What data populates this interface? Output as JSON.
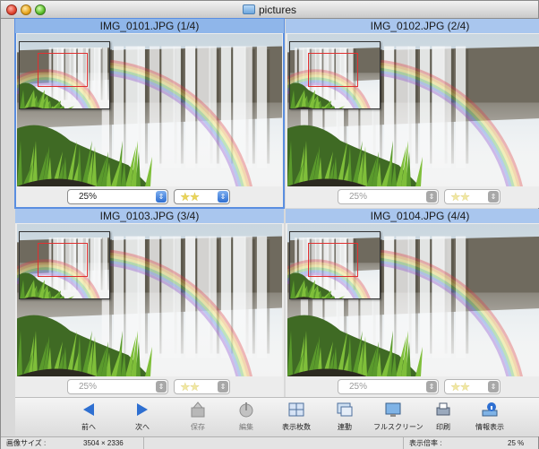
{
  "window": {
    "title": "pictures"
  },
  "cells": [
    {
      "title": "IMG_0101.JPG (1/4)",
      "zoom": "25%",
      "rating_stars": 2,
      "selected": true
    },
    {
      "title": "IMG_0102.JPG (2/4)",
      "zoom": "25%",
      "rating_stars": 2,
      "selected": false
    },
    {
      "title": "IMG_0103.JPG (3/4)",
      "zoom": "25%",
      "rating_stars": 2,
      "selected": false
    },
    {
      "title": "IMG_0104.JPG (4/4)",
      "zoom": "25%",
      "rating_stars": 2,
      "selected": false
    }
  ],
  "toolbar": {
    "prev_label": "前へ",
    "next_label": "次へ",
    "save_label": "保存",
    "edit_label": "編集",
    "display_count_label": "表示枚数",
    "slideshow_label": "連動",
    "fullscreen_label": "フルスクリーン",
    "print_label": "印刷",
    "info_label": "情報表示"
  },
  "statusbar": {
    "image_size_label": "画像サイズ :",
    "image_size_value": "3504 × 2336",
    "zoom_label": "表示倍率 :",
    "zoom_value": "25 %"
  },
  "icons": {
    "prev": "left-arrow-icon",
    "next": "right-arrow-icon",
    "save": "save-icon",
    "edit": "edit-icon",
    "display_count": "grid-icon",
    "slideshow": "link-icon",
    "fullscreen": "fullscreen-icon",
    "print": "print-icon",
    "info": "info-icon"
  },
  "colors": {
    "selection": "#5a8ee0",
    "header": "#a9c6ee",
    "nav_arrow": "#2e6fd1"
  }
}
